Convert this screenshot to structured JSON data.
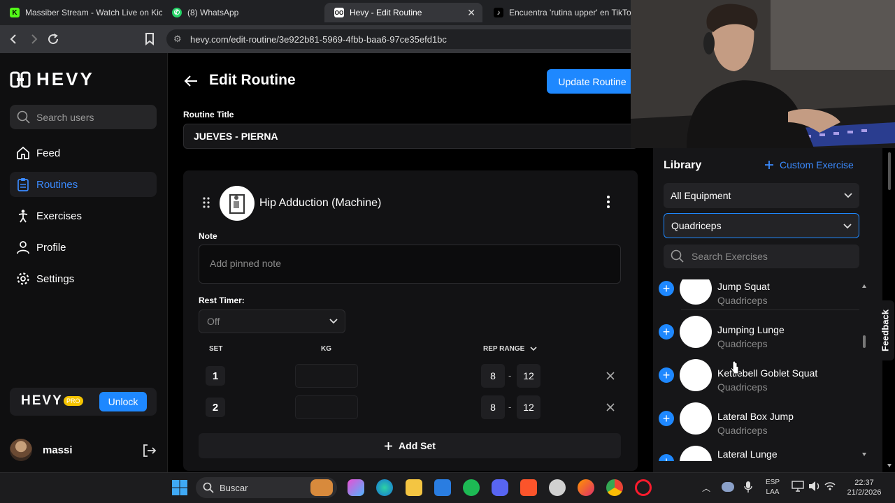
{
  "browser": {
    "tabs": [
      {
        "label": "Massiber Stream - Watch Live on Kick",
        "icon": "kick-icon"
      },
      {
        "label": "(8) WhatsApp",
        "icon": "whatsapp-icon"
      },
      {
        "label": "Hevy - Edit Routine",
        "icon": "hevy-icon"
      },
      {
        "label": "Encuentra 'rutina upper' en TikTok |",
        "icon": "tiktok-icon"
      }
    ],
    "url": "hevy.com/edit-routine/3e922b81-5969-4fbb-baa6-97ce35efd1bc"
  },
  "sidebar": {
    "logo": "HEVY",
    "search_placeholder": "Search users",
    "items": [
      {
        "label": "Feed",
        "icon": "home-icon"
      },
      {
        "label": "Routines",
        "icon": "clipboard-icon"
      },
      {
        "label": "Exercises",
        "icon": "dumbbell-icon"
      },
      {
        "label": "Profile",
        "icon": "person-icon"
      },
      {
        "label": "Settings",
        "icon": "gear-icon"
      }
    ],
    "pro_logo": "HEVY",
    "pro_badge": "PRO",
    "unlock_label": "Unlock",
    "username": "massi"
  },
  "main": {
    "title": "Edit Routine",
    "update_button": "Update Routine",
    "routine_title_label": "Routine Title",
    "routine_title_value": "JUEVES - PIERNA",
    "exercise": {
      "name": "Hip Adduction (Machine)",
      "note_label": "Note",
      "note_placeholder": "Add pinned note",
      "rest_timer_label": "Rest Timer:",
      "rest_timer_value": "Off",
      "headers": {
        "set": "SET",
        "kg": "KG",
        "rep_range": "REP RANGE"
      },
      "sets": [
        {
          "number": "1",
          "kg": "",
          "rep_min": "8",
          "rep_max": "12"
        },
        {
          "number": "2",
          "kg": "",
          "rep_min": "8",
          "rep_max": "12"
        }
      ],
      "rep_separator": "-",
      "add_set_label": "Add Set"
    }
  },
  "library": {
    "title": "Library",
    "custom_exercise": "Custom Exercise",
    "equipment_value": "All Equipment",
    "muscle_value": "Quadriceps",
    "search_placeholder": "Search Exercises",
    "items": [
      {
        "name": "Jump Squat",
        "muscle": "Quadriceps"
      },
      {
        "name": "Jumping Lunge",
        "muscle": "Quadriceps"
      },
      {
        "name": "Kettlebell Goblet Squat",
        "muscle": "Quadriceps"
      },
      {
        "name": "Lateral Box Jump",
        "muscle": "Quadriceps"
      },
      {
        "name": "Lateral Lunge",
        "muscle": ""
      }
    ],
    "feedback_label": "Feedback"
  },
  "taskbar": {
    "search_label": "Buscar",
    "language": "ESP",
    "language_sub": "LAA",
    "time": "22:37",
    "date": "21/2/2026"
  },
  "colors": {
    "accent": "#1e88ff",
    "background": "#000000",
    "sidebar": "#0f0f10",
    "card": "#121214"
  }
}
